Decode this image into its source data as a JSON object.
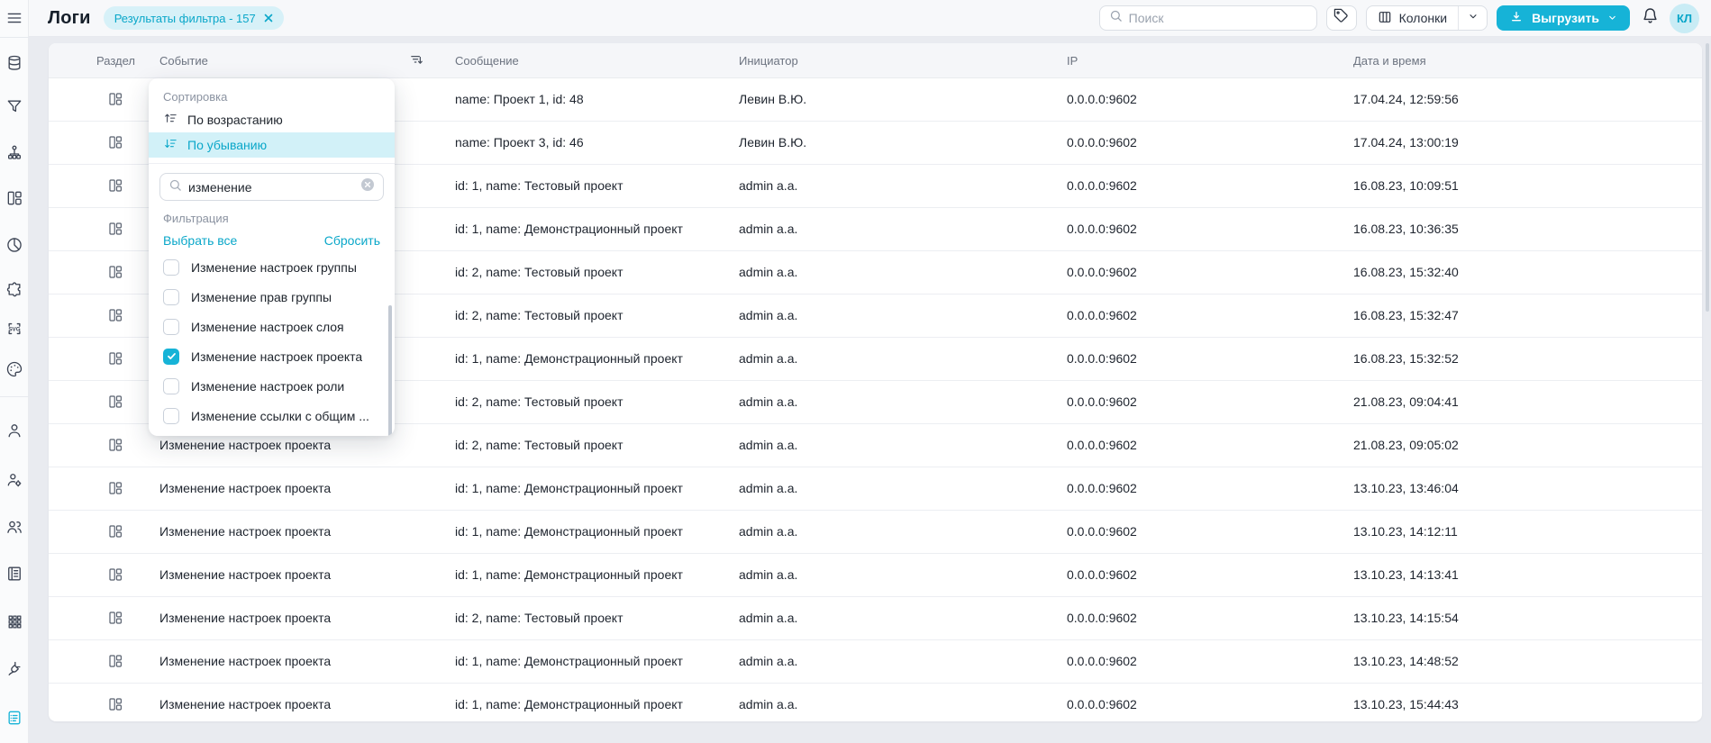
{
  "colors": {
    "accent": "#16b3d7",
    "accent_light": "#d2f1f8",
    "chip_bg": "#d7f1f8",
    "link": "#0aa7c9",
    "page_bg": "#e9ebf0"
  },
  "topbar": {
    "title": "Логи",
    "filter_chip_label": "Результаты фильтра - 157",
    "search_placeholder": "Поиск",
    "columns_button_label": "Колонки",
    "export_button_label": "Выгрузить"
  },
  "user": {
    "initials": "КЛ"
  },
  "sidebar": {
    "icons": [
      "menu",
      "database",
      "filter",
      "sitemap",
      "dashboard",
      "pie-chart",
      "puzzle",
      "svg",
      "palette",
      "user",
      "user-settings",
      "users",
      "journal",
      "apps-grid",
      "plug",
      "logs"
    ],
    "active_icon": "logs"
  },
  "event_dropdown": {
    "sort_section_label": "Сортировка",
    "sort_asc_label": "По возрастанию",
    "sort_desc_label": "По убыванию",
    "selected_sort": "По убыванию",
    "search_value": "изменение",
    "filter_section_label": "Фильтрация",
    "select_all_label": "Выбрать все",
    "reset_label": "Сбросить",
    "options": [
      {
        "label": "Изменение настроек группы",
        "checked": false
      },
      {
        "label": "Изменение прав группы",
        "checked": false
      },
      {
        "label": "Изменение настроек слоя",
        "checked": false
      },
      {
        "label": "Изменение настроек проекта",
        "checked": true
      },
      {
        "label": "Изменение настроек роли",
        "checked": false
      },
      {
        "label": "Изменение ссылки с общим ...",
        "checked": false
      }
    ]
  },
  "table": {
    "columns": [
      "Раздел",
      "Событие",
      "Сообщение",
      "Инициатор",
      "IP",
      "Дата и время"
    ],
    "rows": [
      {
        "event": "",
        "message": "name: Проект 1, id: 48",
        "initiator": "Левин В.Ю.",
        "ip": "0.0.0.0:9602",
        "datetime": "17.04.24, 12:59:56"
      },
      {
        "event": "",
        "message": "name: Проект 3, id: 46",
        "initiator": "Левин В.Ю.",
        "ip": "0.0.0.0:9602",
        "datetime": "17.04.24, 13:00:19"
      },
      {
        "event": "",
        "message": "id: 1, name: Тестовый проект",
        "initiator": "admin a.a.",
        "ip": "0.0.0.0:9602",
        "datetime": "16.08.23, 10:09:51"
      },
      {
        "event": "",
        "message": "id: 1, name: Демонстрационный проект",
        "initiator": "admin a.a.",
        "ip": "0.0.0.0:9602",
        "datetime": "16.08.23, 10:36:35"
      },
      {
        "event": "",
        "message": "id: 2, name: Тестовый проект",
        "initiator": "admin a.a.",
        "ip": "0.0.0.0:9602",
        "datetime": "16.08.23, 15:32:40"
      },
      {
        "event": "",
        "message": "id: 2, name: Тестовый проект",
        "initiator": "admin a.a.",
        "ip": "0.0.0.0:9602",
        "datetime": "16.08.23, 15:32:47"
      },
      {
        "event": "",
        "message": "id: 1, name: Демонстрационный проект",
        "initiator": "admin a.a.",
        "ip": "0.0.0.0:9602",
        "datetime": "16.08.23, 15:32:52"
      },
      {
        "event": "",
        "message": "id: 2, name: Тестовый проект",
        "initiator": "admin a.a.",
        "ip": "0.0.0.0:9602",
        "datetime": "21.08.23, 09:04:41"
      },
      {
        "event": "Изменение настроек проекта",
        "message": "id: 2, name: Тестовый проект",
        "initiator": "admin a.a.",
        "ip": "0.0.0.0:9602",
        "datetime": "21.08.23, 09:05:02"
      },
      {
        "event": "Изменение настроек проекта",
        "message": "id: 1, name: Демонстрационный проект",
        "initiator": "admin a.a.",
        "ip": "0.0.0.0:9602",
        "datetime": "13.10.23, 13:46:04"
      },
      {
        "event": "Изменение настроек проекта",
        "message": "id: 1, name: Демонстрационный проект",
        "initiator": "admin a.a.",
        "ip": "0.0.0.0:9602",
        "datetime": "13.10.23, 14:12:11"
      },
      {
        "event": "Изменение настроек проекта",
        "message": "id: 1, name: Демонстрационный проект",
        "initiator": "admin a.a.",
        "ip": "0.0.0.0:9602",
        "datetime": "13.10.23, 14:13:41"
      },
      {
        "event": "Изменение настроек проекта",
        "message": "id: 2, name: Тестовый проект",
        "initiator": "admin a.a.",
        "ip": "0.0.0.0:9602",
        "datetime": "13.10.23, 14:15:54"
      },
      {
        "event": "Изменение настроек проекта",
        "message": "id: 1, name: Демонстрационный проект",
        "initiator": "admin a.a.",
        "ip": "0.0.0.0:9602",
        "datetime": "13.10.23, 14:48:52"
      },
      {
        "event": "Изменение настроек проекта",
        "message": "id: 1, name: Демонстрационный проект",
        "initiator": "admin a.a.",
        "ip": "0.0.0.0:9602",
        "datetime": "13.10.23, 15:44:43"
      }
    ]
  }
}
